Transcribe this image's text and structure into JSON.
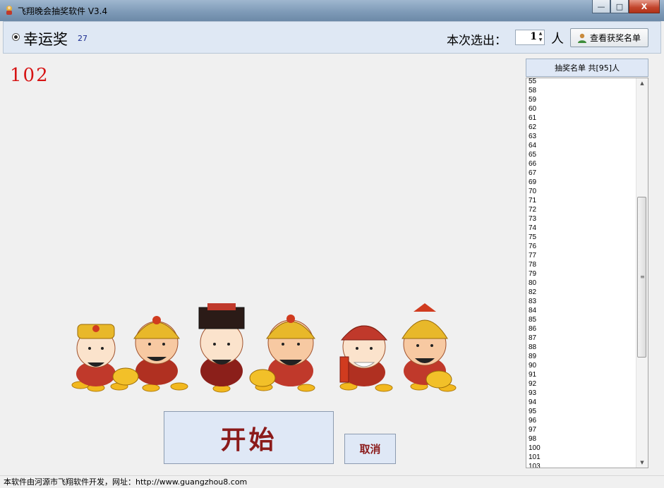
{
  "window": {
    "title": "飞翔晚会抽奖软件 V3.4",
    "controls": {
      "minimize": "—",
      "maximize": "□",
      "close": "X"
    }
  },
  "header": {
    "prize_name": "幸运奖",
    "prize_count": "27",
    "select_label": "本次选出：",
    "select_count": "1",
    "person_unit": "人",
    "view_winners_label": "查看获奖名单",
    "view_winners_icon": "person-icon"
  },
  "stage": {
    "current_number": "102",
    "start_label": "开始",
    "cancel_label": "取消",
    "artwork": "cartoon-gods-of-wealth"
  },
  "list_panel": {
    "header": "抽奖名单 共[95]人",
    "items": [
      "55",
      "58",
      "59",
      "60",
      "61",
      "62",
      "63",
      "64",
      "65",
      "66",
      "67",
      "69",
      "70",
      "71",
      "72",
      "73",
      "74",
      "75",
      "76",
      "77",
      "78",
      "79",
      "80",
      "82",
      "83",
      "84",
      "85",
      "86",
      "87",
      "88",
      "89",
      "90",
      "91",
      "92",
      "93",
      "94",
      "95",
      "96",
      "97",
      "98",
      "100",
      "101",
      "103"
    ],
    "scroll_position": 0.52
  },
  "status_bar": {
    "text": "本软件由河源市飞翔软件开发，网址：http://www.guangzhou8.com"
  },
  "colors": {
    "number_red": "#d61414",
    "button_text": "#8b1a1a",
    "header_bg": "#dfe8f4"
  }
}
